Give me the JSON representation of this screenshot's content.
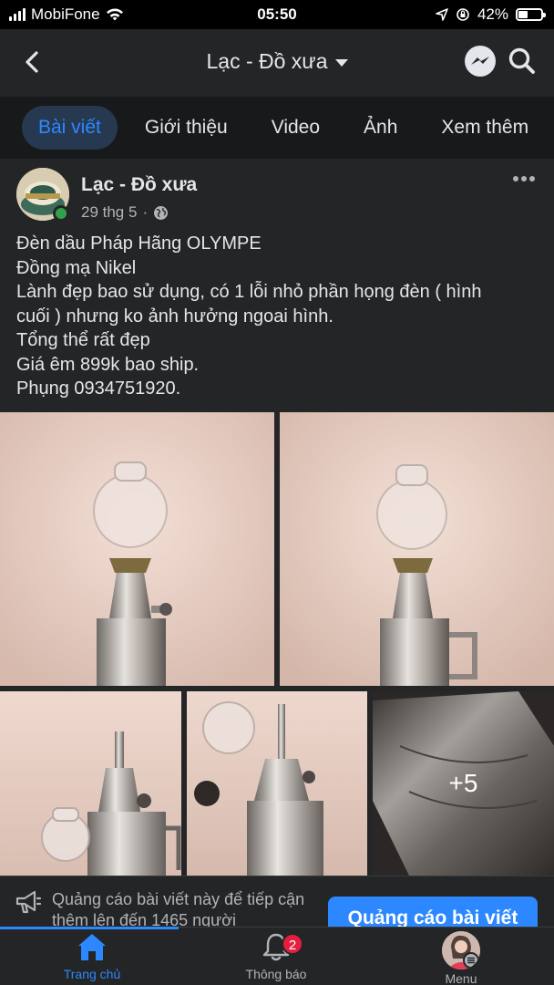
{
  "status_bar": {
    "carrier": "MobiFone",
    "time": "05:50",
    "battery_percent": "42%",
    "battery_level": 0.42
  },
  "header": {
    "page_name": "Lạc - Đồ xưa"
  },
  "tabs": [
    {
      "label": "Bài viết",
      "active": true
    },
    {
      "label": "Giới thiệu",
      "active": false
    },
    {
      "label": "Video",
      "active": false
    },
    {
      "label": "Ảnh",
      "active": false
    },
    {
      "label": "Xem thêm",
      "active": false
    }
  ],
  "post": {
    "author": "Lạc - Đồ xưa",
    "date": "29 thg 5",
    "privacy_icon": "globe-icon",
    "lines": [
      "Đèn dầu Pháp Hãng OLYMPE",
      "Đồng mạ Nikel",
      "Lành đẹp bao sử dụng, có 1 lỗi nhỏ phần họng đèn ( hình",
      "cuối ) nhưng ko ảnh hưởng ngoai hình.",
      "Tổng thể rất đẹp",
      "Giá êm 899k bao ship.",
      "Phụng 0934751920."
    ],
    "more_photos": "+5"
  },
  "promo": {
    "text": "Quảng cáo bài viết này để tiếp cận thêm lên đến 1465 người",
    "button": "Quảng cáo bài viết"
  },
  "bottom_nav": {
    "home": "Trang chủ",
    "notifications": "Thông báo",
    "notification_count": "2",
    "menu": "Menu"
  },
  "colors": {
    "accent": "#2d88ff",
    "background": "#18191a",
    "surface": "#242526",
    "online": "#31a24c",
    "badge": "#e41e3f"
  }
}
